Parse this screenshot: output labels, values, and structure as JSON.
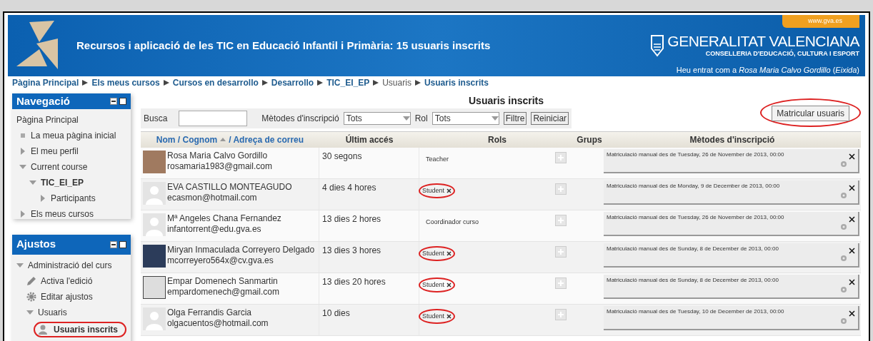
{
  "header": {
    "title": "Recursos i aplicació de les TIC en Educació Infantil i Primària: 15 usuaris inscrits",
    "site_tab": "www.gva.es",
    "org_name": "GENERALITAT VALENCIANA",
    "org_sub": "CONSELLERIA D'EDUCACIÓ, CULTURA I ESPORT",
    "login": "Heu entrat com a *Rosa Maria Calvo Gordillo* (*Eixida*)"
  },
  "breadcrumb": [
    {
      "label": "Pàgina Principal",
      "link": true
    },
    {
      "label": "Els meus cursos",
      "link": true
    },
    {
      "label": "Cursos en desarrollo",
      "link": true
    },
    {
      "label": "Desarrollo",
      "link": true
    },
    {
      "label": "TIC_EI_EP",
      "link": true
    },
    {
      "label": "Usuaris",
      "link": false
    },
    {
      "label": "Usuaris inscrits",
      "link": true
    }
  ],
  "navigation": {
    "title": "Navegació",
    "items": [
      {
        "label": "Pàgina Principal",
        "kind": "home",
        "children": [
          {
            "label": "La meua pàgina inicial",
            "kind": "leaf"
          },
          {
            "label": "El meu perfil",
            "kind": "branch",
            "expanded": false
          },
          {
            "label": "Current course",
            "kind": "branch",
            "expanded": true,
            "children": [
              {
                "label": "TIC_EI_EP",
                "kind": "branch",
                "expanded": true,
                "bold": true,
                "children": [
                  {
                    "label": "Participants",
                    "kind": "branch",
                    "expanded": false
                  }
                ]
              }
            ]
          },
          {
            "label": "Els meus cursos",
            "kind": "branch",
            "expanded": false
          }
        ]
      }
    ]
  },
  "settings": {
    "title": "Ajustos",
    "items": [
      {
        "label": "Administració del curs",
        "kind": "branch",
        "expanded": true,
        "children": [
          {
            "label": "Activa l'edició",
            "kind": "pencil"
          },
          {
            "label": "Editar ajustos",
            "kind": "gear"
          },
          {
            "label": "Usuaris",
            "kind": "branch",
            "expanded": true,
            "children": [
              {
                "label": "Usuaris inscrits",
                "kind": "user",
                "bold": true,
                "circled": true
              }
            ]
          }
        ]
      }
    ]
  },
  "main": {
    "title": "Usuaris inscrits",
    "filters": {
      "search_label": "Busca",
      "method_label": "Mètodes d'inscripció",
      "method_value": "Tots",
      "role_label": "Rol",
      "role_value": "Tots",
      "filter_button": "Filtre",
      "reset_button": "Reiniciar"
    },
    "enrol_button": {
      "label": "Matricular usuaris",
      "circled": true
    },
    "columns": {
      "name": "Nom / Cognom",
      "email": "/ Adreça de correu",
      "last_access": "Últim accés",
      "roles": "Rols",
      "groups": "Grups",
      "methods": "Mètodes d'inscripció"
    },
    "rows": [
      {
        "kind": "photo",
        "name": "Rosa Maria Calvo Gordillo",
        "email": "rosamaria1983@gmail.com",
        "last_access": "30 segons",
        "role": "Teacher",
        "removable": false,
        "circled": false,
        "method": "Matriculació manual des de Tuesday, 26 de November de 2013, 00:00"
      },
      {
        "kind": "default",
        "name": "EVA CASTILLO MONTEAGUDO",
        "email": "ecasmon@hotmail.com",
        "last_access": "4 dies 4 hores",
        "role": "Student",
        "removable": true,
        "circled": true,
        "method": "Matriculació manual des de Monday, 9 de December de 2013, 00:00"
      },
      {
        "kind": "default",
        "name": "Mª Angeles Chana Fernandez",
        "email": "infantorrent@edu.gva.es",
        "last_access": "13 dies 2 hores",
        "role": "Coordinador curso",
        "removable": false,
        "circled": false,
        "method": "Matriculació manual des de Tuesday, 26 de November de 2013, 00:00"
      },
      {
        "kind": "painting",
        "name": "Miryan Inmaculada Correyero Delgado",
        "email": "mcorreyero564x@cv.gva.es",
        "last_access": "13 dies 3 hores",
        "role": "Student",
        "removable": true,
        "circled": true,
        "method": "Matriculació manual des de Sunday, 8 de December de 2013, 00:00"
      },
      {
        "kind": "sketch",
        "name": "Empar Domenech Sanmartin",
        "email": "empardomenech@gmail.com",
        "last_access": "13 dies 20 hores",
        "role": "Student",
        "removable": true,
        "circled": true,
        "method": "Matriculació manual des de Sunday, 8 de December de 2013, 00:00"
      },
      {
        "kind": "default",
        "name": "Olga Ferrandis Garcia",
        "email": "olgacuentos@hotmail.com",
        "last_access": "10 dies",
        "role": "Student",
        "removable": true,
        "circled": true,
        "method": "Matriculació manual des de Tuesday, 10 de December de 2013, 00:00"
      }
    ]
  }
}
